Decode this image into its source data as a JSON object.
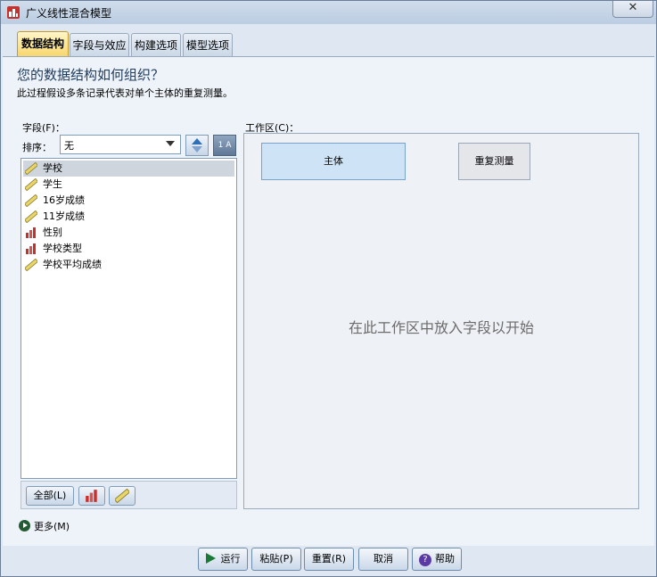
{
  "window": {
    "title": "广义线性混合模型",
    "close_glyph": "✕"
  },
  "tabs": [
    {
      "label": "数据结构",
      "active": true
    },
    {
      "label": "字段与效应",
      "active": false
    },
    {
      "label": "构建选项",
      "active": false
    },
    {
      "label": "模型选项",
      "active": false
    }
  ],
  "heading": "您的数据结构如何组织？",
  "description": "此过程假设多条记录代表对单个主体的重复测量。",
  "fields_panel": {
    "label": "字段(F)：",
    "sort_label": "排序：",
    "sort_value": "无",
    "sort_az_glyph": "1 A",
    "items": [
      {
        "label": "学校",
        "icon": "ruler-icon",
        "selected": true
      },
      {
        "label": "学生",
        "icon": "ruler-icon",
        "selected": false
      },
      {
        "label": "16岁成绩",
        "icon": "ruler-icon",
        "selected": false
      },
      {
        "label": "11岁成绩",
        "icon": "ruler-icon",
        "selected": false
      },
      {
        "label": "性别",
        "icon": "bar-chart-icon",
        "selected": false
      },
      {
        "label": "学校类型",
        "icon": "bar-chart-icon",
        "selected": false
      },
      {
        "label": "学校平均成绩",
        "icon": "ruler-icon",
        "selected": false
      }
    ],
    "all_button": "全部(L)"
  },
  "workspace": {
    "label": "工作区(C)：",
    "subject_label": "主体",
    "repeated_label": "重复测量",
    "hint": "在此工作区中放入字段以开始"
  },
  "more_link": "更多(M)",
  "footer": {
    "run": "运行",
    "paste": "粘贴(P)",
    "reset": "重置(R)",
    "cancel": "取消",
    "help": "帮助",
    "help_glyph": "?"
  },
  "colors": {
    "active_tab": "#f7d66c",
    "subject_fill": "#cfe3f6",
    "run_green": "#1b7a36"
  }
}
